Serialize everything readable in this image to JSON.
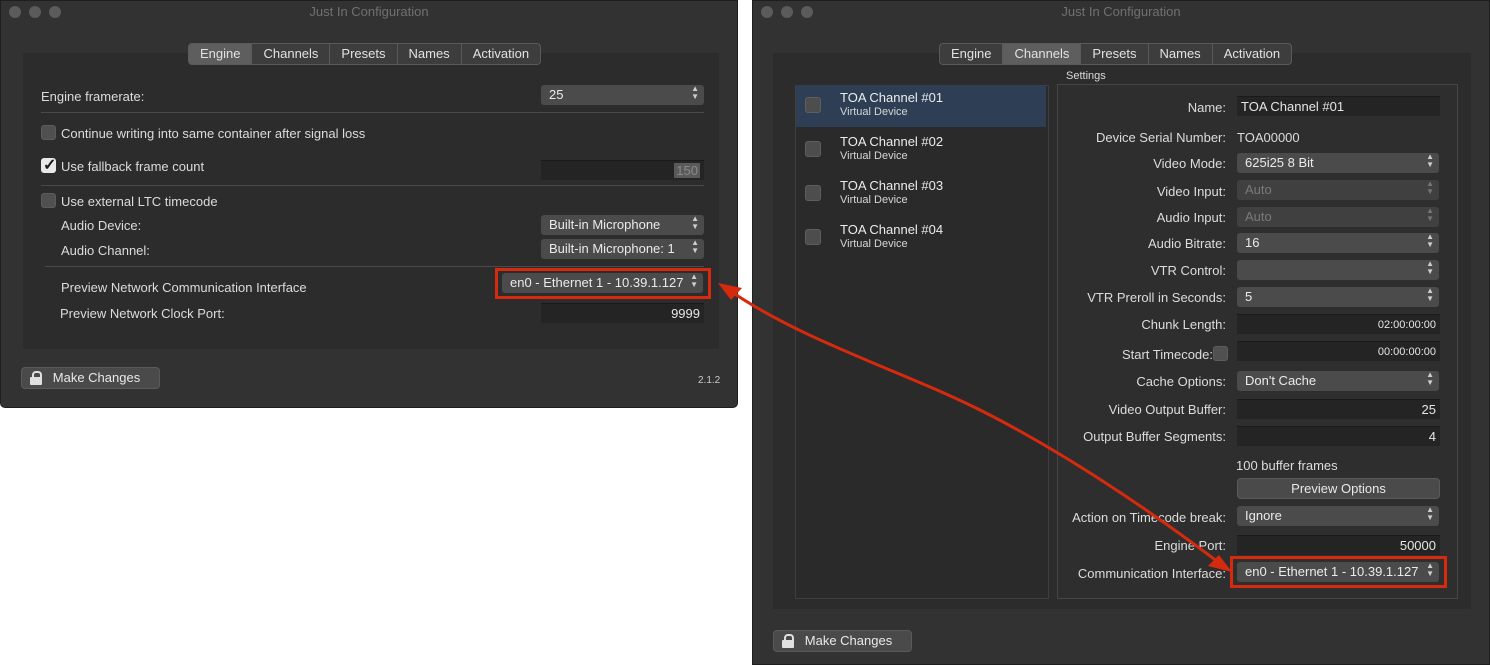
{
  "window_title": "Just In Configuration",
  "tabs": [
    "Engine",
    "Channels",
    "Presets",
    "Names",
    "Activation"
  ],
  "engine": {
    "framerate_label": "Engine framerate:",
    "framerate_value": "25",
    "continue_writing_label": "Continue writing into same container after signal loss",
    "continue_writing_checked": false,
    "fallback_label": "Use fallback frame count",
    "fallback_checked": true,
    "fallback_value": "150",
    "ltc_label": "Use external LTC timecode",
    "ltc_checked": false,
    "audio_device_label": "Audio Device:",
    "audio_device_value": "Built-in Microphone",
    "audio_channel_label": "Audio Channel:",
    "audio_channel_value": "Built-in Microphone: 1",
    "preview_iface_label": "Preview Network Communication Interface",
    "preview_iface_value": "en0 - Ethernet 1 - 10.39.1.127",
    "preview_port_label": "Preview Network Clock Port:",
    "preview_port_value": "9999",
    "make_changes": "Make Changes",
    "version": "2.1.2"
  },
  "channels": {
    "settings_label": "Settings",
    "list": [
      {
        "name": "TOA Channel #01",
        "sub": "Virtual Device"
      },
      {
        "name": "TOA Channel #02",
        "sub": "Virtual Device"
      },
      {
        "name": "TOA Channel #03",
        "sub": "Virtual Device"
      },
      {
        "name": "TOA Channel #04",
        "sub": "Virtual Device"
      }
    ],
    "name_label": "Name:",
    "name_value": "TOA Channel #01",
    "serial_label": "Device Serial Number:",
    "serial_value": "TOA00000",
    "video_mode_label": "Video Mode:",
    "video_mode_value": "625i25 8 Bit",
    "video_input_label": "Video Input:",
    "video_input_value": "Auto",
    "audio_input_label": "Audio Input:",
    "audio_input_value": "Auto",
    "audio_bitrate_label": "Audio Bitrate:",
    "audio_bitrate_value": "16",
    "vtr_control_label": "VTR Control:",
    "vtr_control_value": "",
    "vtr_preroll_label": "VTR Preroll in Seconds:",
    "vtr_preroll_value": "5",
    "chunk_length_label": "Chunk Length:",
    "chunk_length_value": "02:00:00:00",
    "start_tc_label": "Start Timecode:",
    "start_tc_value": "00:00:00:00",
    "cache_label": "Cache Options:",
    "cache_value": "Don't Cache",
    "video_buffer_label": "Video Output Buffer:",
    "video_buffer_value": "25",
    "buffer_segments_label": "Output Buffer Segments:",
    "buffer_segments_value": "4",
    "buffer_frames_text": "100 buffer frames",
    "preview_options": "Preview Options",
    "tc_break_label": "Action on Timecode break:",
    "tc_break_value": "Ignore",
    "engine_port_label": "Engine Port:",
    "engine_port_value": "50000",
    "comm_iface_label": "Communication Interface:",
    "comm_iface_value": "en0 - Ethernet 1 - 10.39.1.127",
    "make_changes": "Make Changes"
  },
  "colors": {
    "highlight": "#d62a0e",
    "window_bg": "#323232",
    "selection": "#2e3f55"
  }
}
